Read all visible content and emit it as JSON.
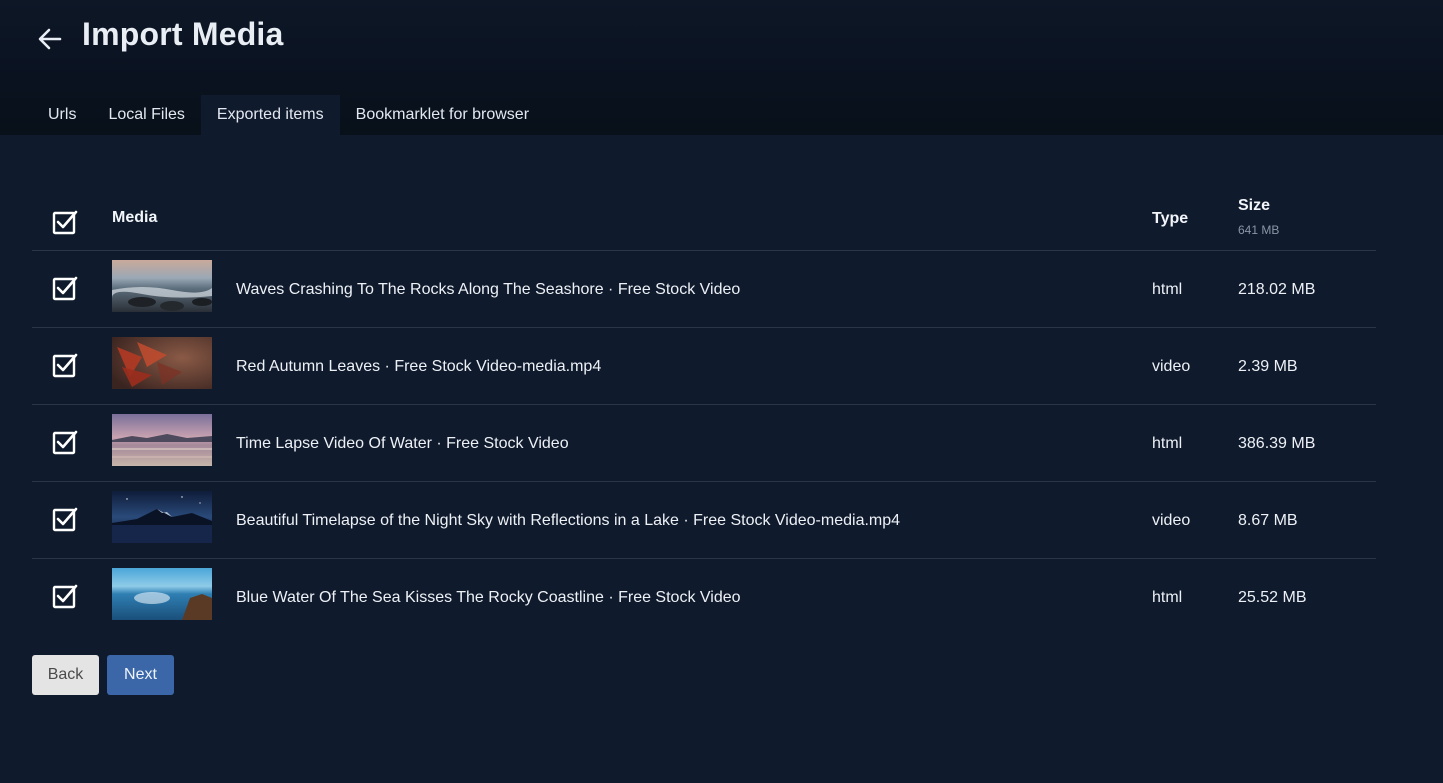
{
  "header": {
    "title": "Import Media",
    "tabs": [
      {
        "label": "Urls"
      },
      {
        "label": "Local Files"
      },
      {
        "label": "Exported items"
      },
      {
        "label": "Bookmarklet for browser"
      }
    ]
  },
  "table": {
    "headers": {
      "media": "Media",
      "type": "Type",
      "size": "Size"
    },
    "total_size": "641 MB",
    "rows": [
      {
        "name": "Waves Crashing To The Rocks Along The Seashore · Free Stock Video",
        "type": "html",
        "size": "218.02 MB",
        "checked": true
      },
      {
        "name": "Red Autumn Leaves · Free Stock Video-media.mp4",
        "type": "video",
        "size": "2.39 MB",
        "checked": true
      },
      {
        "name": "Time Lapse Video Of Water · Free Stock Video",
        "type": "html",
        "size": "386.39 MB",
        "checked": true
      },
      {
        "name": "Beautiful Timelapse of the Night Sky with Reflections in a Lake · Free Stock Video-media.mp4",
        "type": "video",
        "size": "8.67 MB",
        "checked": true
      },
      {
        "name": "Blue Water Of The Sea Kisses The Rocky Coastline · Free Stock Video",
        "type": "html",
        "size": "25.52 MB",
        "checked": true
      }
    ]
  },
  "buttons": {
    "back": "Back",
    "next": "Next"
  },
  "icons": {
    "back": "arrow-left-icon",
    "checkbox": "checkbox-checked-icon"
  },
  "colors": {
    "background": "#0f1a2c",
    "primary": "#3b67a8",
    "secondary": "#e4e4e4"
  }
}
